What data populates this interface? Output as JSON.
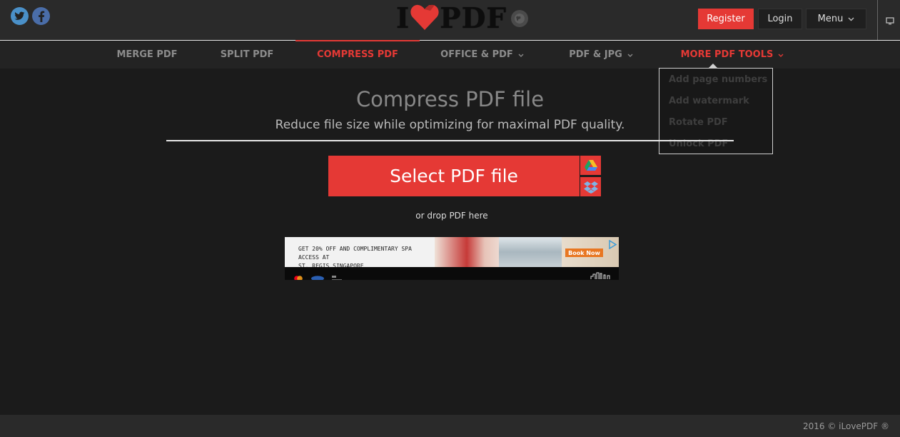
{
  "header": {
    "social": {
      "twitter_icon": "twitter-icon",
      "facebook_icon": "facebook-icon"
    },
    "logo": {
      "prefix": "I",
      "suffix": "PDF",
      "heart_icon": "heart-icon"
    },
    "language_icon": "globe-icon",
    "register_label": "Register",
    "login_label": "Login",
    "menu_label": "Menu",
    "desktop_icon": "monitor-icon"
  },
  "nav": {
    "items": [
      {
        "label": "MERGE PDF"
      },
      {
        "label": "SPLIT PDF"
      },
      {
        "label": "COMPRESS PDF",
        "active": true
      },
      {
        "label": "OFFICE & PDF",
        "dropdown": true
      },
      {
        "label": "PDF & JPG",
        "dropdown": true
      },
      {
        "label": "MORE PDF TOOLS",
        "dropdown": true,
        "open": true
      }
    ]
  },
  "dropdown": {
    "items": [
      {
        "label": "Add page numbers"
      },
      {
        "label": "Add watermark"
      },
      {
        "label": "Rotate PDF"
      },
      {
        "label": "Unlock PDF"
      }
    ]
  },
  "main": {
    "title": "Compress PDF file",
    "subtitle": "Reduce file size while optimizing for maximal PDF quality.",
    "select_label": "Select PDF file",
    "drop_text": "or drop PDF here",
    "gdrive_icon": "google-drive-icon",
    "dropbox_icon": "dropbox-icon"
  },
  "ad": {
    "line1": "GET 20% OFF AND COMPLIMENTARY SPA ACCESS AT",
    "line2": "ST. REGIS SINGAPORE",
    "cta": "Book Now"
  },
  "footer": {
    "copyright": "2016 © iLovePDF ®"
  },
  "colors": {
    "accent": "#e53935",
    "background": "#1b1b1b",
    "header": "#2a2a2a"
  }
}
